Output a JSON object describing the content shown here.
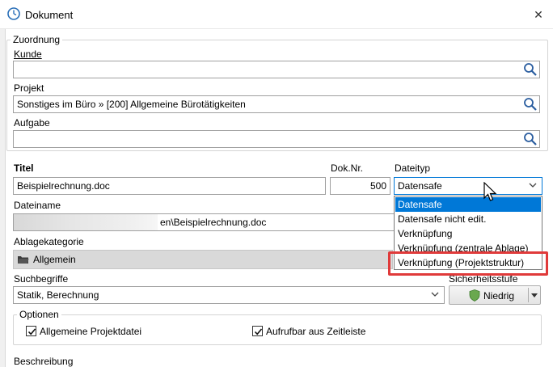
{
  "window": {
    "title": "Dokument",
    "close_glyph": "✕"
  },
  "zuordnung": {
    "legend": "Zuordnung",
    "kunde": {
      "label": "Kunde",
      "value": ""
    },
    "projekt": {
      "label": "Projekt",
      "value": "Sonstiges im Büro » [200] Allgemeine Bürotätigkeiten"
    },
    "aufgabe": {
      "label": "Aufgabe",
      "value": ""
    }
  },
  "titel": {
    "label": "Titel",
    "value": "Beispielrechnung.doc"
  },
  "doknr": {
    "label": "Dok.Nr.",
    "value": "500"
  },
  "dateityp": {
    "label": "Dateityp",
    "selected": "Datensafe",
    "options": [
      "Datensafe",
      "Datensafe nicht edit.",
      "Verknüpfung",
      "Verknüpfung (zentrale Ablage)",
      "Verknüpfung (Projektstruktur)"
    ]
  },
  "dateiname": {
    "label": "Dateiname",
    "value": "en\\Beispielrechnung.doc"
  },
  "ablagekategorie": {
    "label": "Ablagekategorie",
    "value": "Allgemein"
  },
  "suchbegriffe": {
    "label": "Suchbegriffe",
    "value": "Statik, Berechnung"
  },
  "sicherheitsstufe": {
    "label": "Sicherheitsstufe",
    "value": "Niedrig"
  },
  "optionen": {
    "legend": "Optionen",
    "allgemeine": {
      "label": "Allgemeine Projektdatei",
      "checked": true
    },
    "aufrufbar": {
      "label": "Aufrufbar aus Zeitleiste",
      "checked": true
    }
  },
  "beschreibung": {
    "label": "Beschreibung"
  },
  "colors": {
    "selection": "#0078d7",
    "highlight": "#e03a3a",
    "shield": "#6aa84f"
  }
}
